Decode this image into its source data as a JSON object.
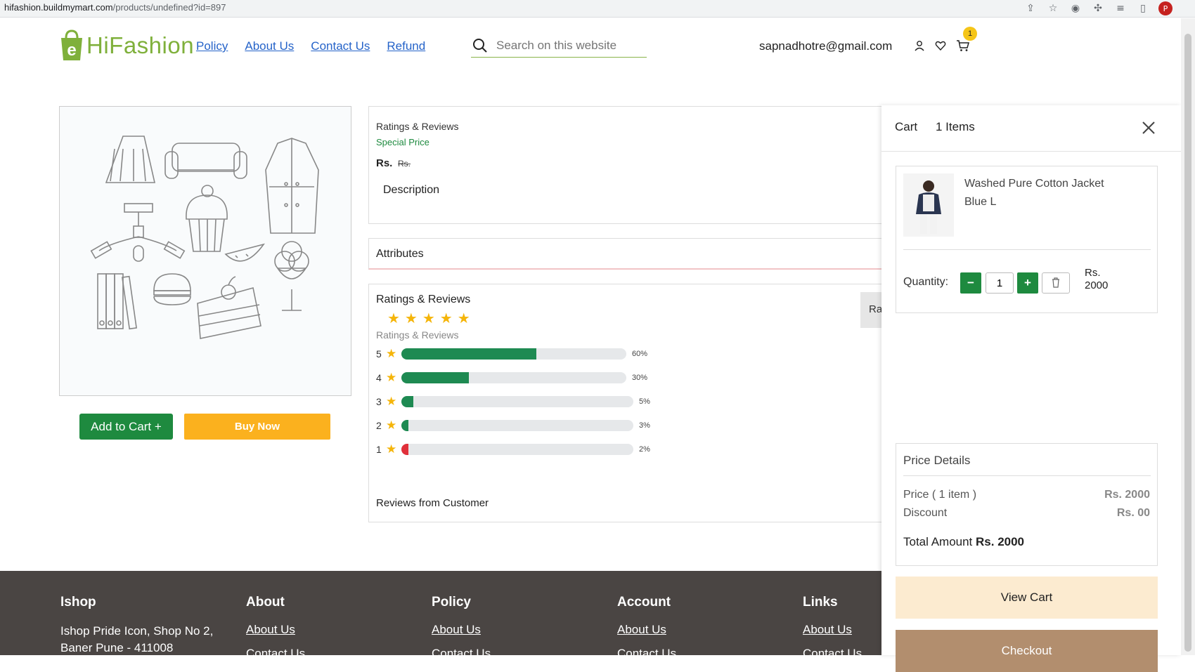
{
  "browser": {
    "url_host": "hifashion.buildmymart.com",
    "url_path": "/products/undefined?id=897",
    "profile_initial": "P"
  },
  "header": {
    "logo_letter": "e",
    "logo_hi": "Hi",
    "logo_fashion": "Fashion",
    "nav": [
      "Policy",
      "About Us",
      "Contact Us",
      "Refund"
    ],
    "search_placeholder": "Search on this website",
    "email": "sapnadhotre@gmail.com",
    "cart_count": "1"
  },
  "product": {
    "add_to_cart": "Add to Cart +",
    "buy_now": "Buy Now",
    "ratings_reviews_label": "Ratings & Reviews",
    "special_price": "Special Price",
    "currency": "Rs.",
    "mrp_currency": "Rs.",
    "description_label": "Description",
    "attributes_label": "Attributes"
  },
  "ratings": {
    "title": "Ratings & Reviews",
    "stars_count": 5,
    "subtitle": "Ratings & Reviews",
    "breakdown": [
      {
        "stars": "5",
        "percent": 60,
        "label": "60%"
      },
      {
        "stars": "4",
        "percent": 30,
        "label": "30%"
      },
      {
        "stars": "3",
        "percent": 5,
        "label": "5%"
      },
      {
        "stars": "2",
        "percent": 3,
        "label": "3%"
      },
      {
        "stars": "1",
        "percent": 2,
        "label": "2%"
      }
    ],
    "reviews_heading": "Reviews from Customer",
    "rate_button_partial": "Ra"
  },
  "cart": {
    "title": "Cart",
    "items_count": "1 Items",
    "item_name_line1": "Washed Pure Cotton Jacket",
    "item_name_line2": "Blue L",
    "quantity_label": "Quantity:",
    "quantity": "1",
    "item_price_currency": "Rs.",
    "item_price_value": "2000",
    "price_details_title": "Price Details",
    "price_label": "Price ( 1 item )",
    "price_value": "Rs. 2000",
    "discount_label": "Discount",
    "discount_value": "Rs. 00",
    "total_label": "Total Amount",
    "total_value": "Rs. 2000",
    "view_cart": "View Cart",
    "checkout": "Checkout"
  },
  "footer": {
    "ishop_title": "Ishop",
    "address_line1": "Ishop Pride Icon, Shop No 2,",
    "address_line2": "Baner Pune - 411008",
    "about_title": "About",
    "policy_title": "Policy",
    "account_title": "Account",
    "links_title": "Links",
    "about_us_link": "About Us",
    "contact_us_link": "Contact Us"
  },
  "colors": {
    "brand_green": "#1e8a3f",
    "buy_now_orange": "#fbb11e",
    "logo_green": "#7fb03b",
    "link_blue": "#2563c9",
    "footer_bg": "#4a4543",
    "checkout_brown": "#b28e6e",
    "star_gold": "#f5b50a"
  }
}
